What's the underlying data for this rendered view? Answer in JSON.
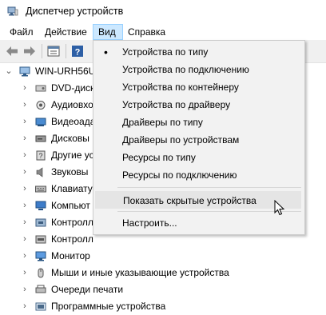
{
  "window": {
    "title": "Диспетчер устройств"
  },
  "menubar": {
    "items": [
      "Файл",
      "Действие",
      "Вид",
      "Справка"
    ],
    "active_index": 2
  },
  "tree": {
    "root": "WIN-URH56U",
    "items": [
      "DVD-диско",
      "Аудиовхо",
      "Видеоада",
      "Дисковы",
      "Другие устро",
      "Звуковы",
      "Клавиату",
      "Компьют",
      "Контролл",
      "Контролл",
      "Монитор",
      "Мыши и иные указывающие устройства",
      "Очереди печати",
      "Программные устройства"
    ]
  },
  "view_menu": {
    "items": [
      "Устройства по типу",
      "Устройства по подключению",
      "Устройства по контейнеру",
      "Устройства по драйверу",
      "Драйверы по типу",
      "Драйверы по устройствам",
      "Ресурсы по типу",
      "Ресурсы по подключению"
    ],
    "checked_index": 0,
    "show_hidden": "Показать скрытые устройства",
    "customize": "Настроить..."
  },
  "colors": {
    "menu_active_bg": "#cce8ff",
    "dropdown_bg": "#f2f2f2",
    "hover_bg": "#e5e5e5"
  }
}
